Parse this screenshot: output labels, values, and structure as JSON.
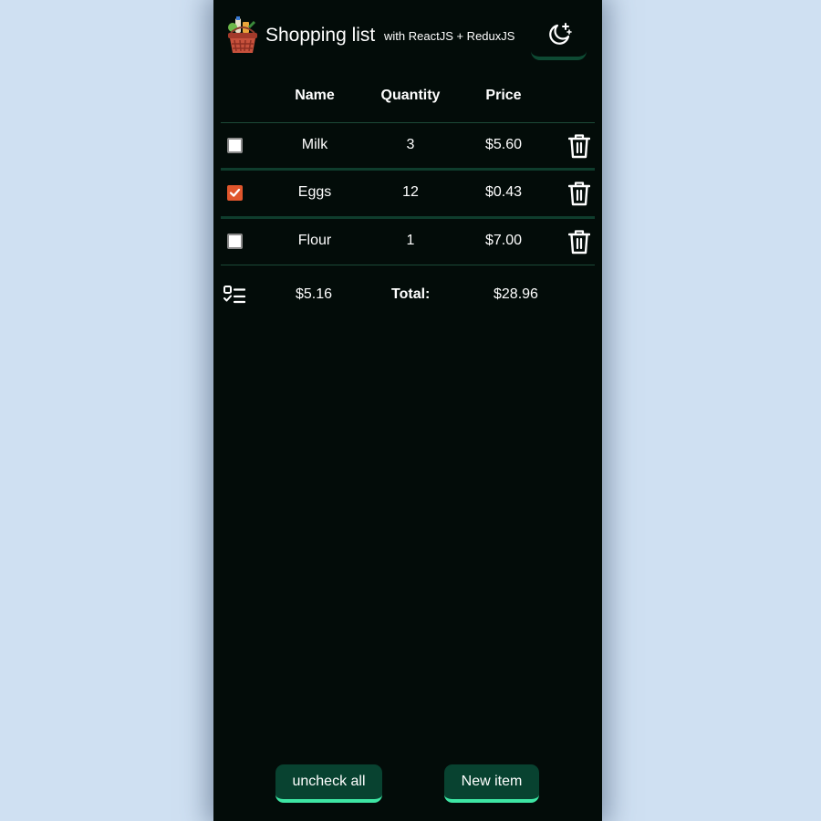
{
  "header": {
    "title": "Shopping list",
    "subtitle": "with ReactJS + ReduxJS"
  },
  "columns": {
    "name": "Name",
    "quantity": "Quantity",
    "price": "Price"
  },
  "items": [
    {
      "name": "Milk",
      "quantity": "3",
      "price": "$5.60",
      "checked": false
    },
    {
      "name": "Eggs",
      "quantity": "12",
      "price": "$0.43",
      "checked": true
    },
    {
      "name": "Flour",
      "quantity": "1",
      "price": "$7.00",
      "checked": false
    }
  ],
  "summary": {
    "checked_total": "$5.16",
    "total_label": "Total:",
    "total": "$28.96"
  },
  "buttons": {
    "uncheck_all": "uncheck all",
    "new_item": "New item"
  },
  "icons": {
    "logo": "shopping-basket-icon",
    "theme": "moon-stars-icon",
    "delete": "trash-icon",
    "summary": "checklist-icon"
  },
  "colors": {
    "background": "#030c09",
    "page": "#cfe0f2",
    "button": "#084230",
    "button_accent": "#3ee6a4",
    "checkbox_checked": "#e0562c"
  }
}
